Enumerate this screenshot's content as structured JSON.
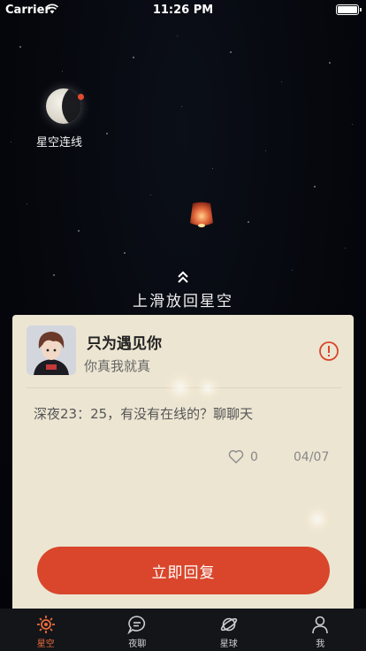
{
  "status_bar": {
    "carrier": "Carrier",
    "time": "11:26 PM"
  },
  "moon": {
    "label": "星空连线",
    "dot_color": "#e24a2e"
  },
  "swipe_hint": {
    "text": "上滑放回星空"
  },
  "card": {
    "username": "只为遇见你",
    "tagline": "你真我就真",
    "message": "深夜23：25，有没有在线的？聊聊天",
    "like_count": "0",
    "date": "04/07",
    "reply_button": "立即回复"
  },
  "tabs": [
    {
      "label": "星空",
      "icon": "sun-icon",
      "active": true
    },
    {
      "label": "夜聊",
      "icon": "chat-bubble-icon",
      "active": false
    },
    {
      "label": "星球",
      "icon": "planet-icon",
      "active": false
    },
    {
      "label": "我",
      "icon": "person-icon",
      "active": false
    }
  ],
  "colors": {
    "accent": "#d9462b",
    "active_tab": "#ea6a3b",
    "card_bg": "#ece5d2",
    "sky": "#05070c"
  }
}
